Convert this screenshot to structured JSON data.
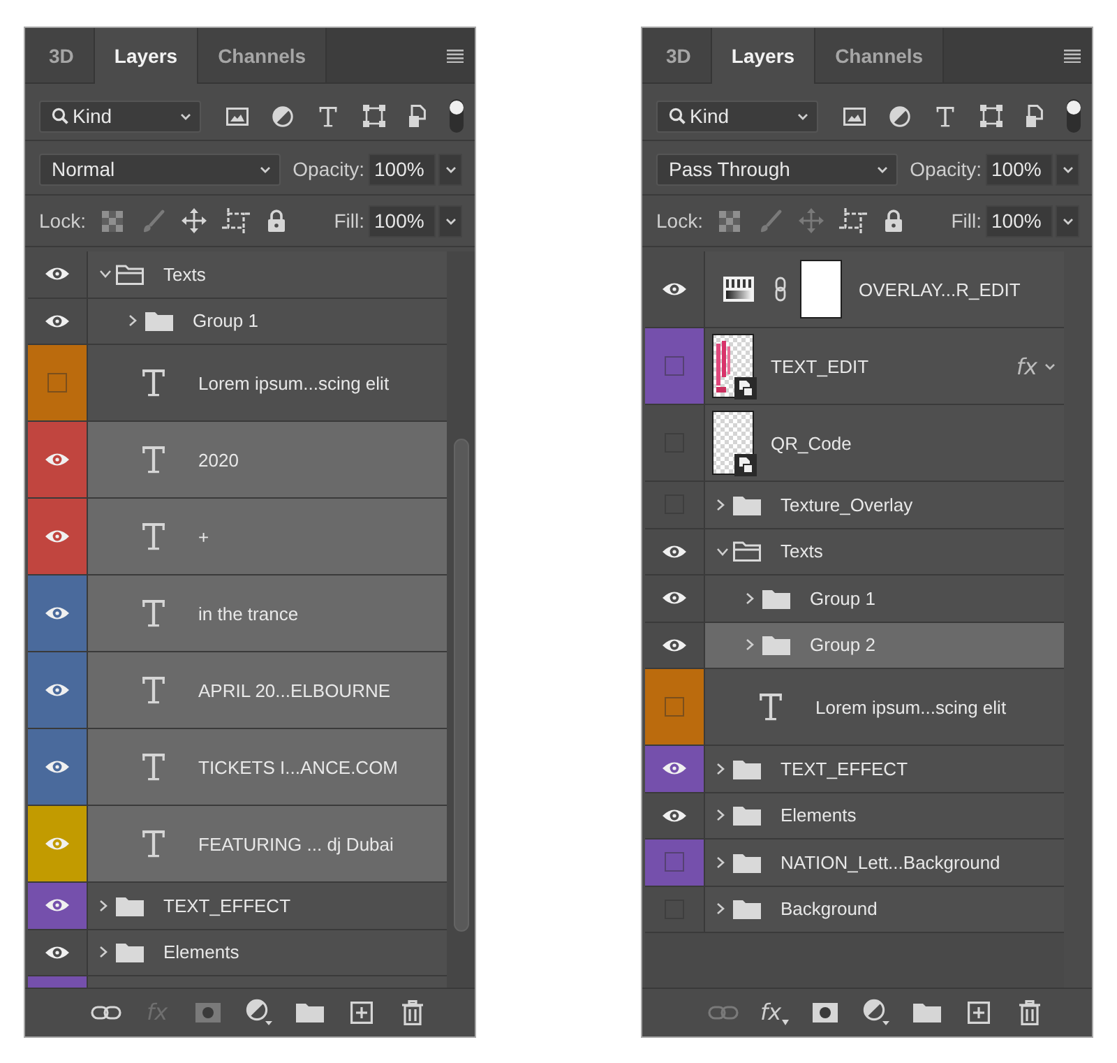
{
  "panels": [
    {
      "tabs": [
        {
          "label": "3D",
          "selected": false
        },
        {
          "label": "Layers",
          "selected": true
        },
        {
          "label": "Channels",
          "selected": false
        }
      ],
      "filter": {
        "label": "Kind",
        "on": true
      },
      "blend_mode": {
        "value": "Normal"
      },
      "opacity": {
        "label": "Opacity:",
        "value": "100%"
      },
      "lock": {
        "label": "Lock:",
        "buttons": [
          {
            "disabled": true
          },
          {
            "disabled": true
          },
          {
            "disabled": false
          },
          {
            "disabled": false
          },
          {
            "disabled": false
          }
        ]
      },
      "fill": {
        "label": "Fill:",
        "value": "100%"
      },
      "scrollable": true,
      "layers": [
        {
          "kind": "folder",
          "name": "Texts",
          "visible": true,
          "selected": false,
          "expanded": true,
          "children": [
            {
              "kind": "folder",
              "name": "Group 1",
              "visible": true,
              "selected": false,
              "expanded": false
            },
            {
              "kind": "text",
              "name": "Lorem ipsum...scing elit",
              "visible": false,
              "selected": false,
              "color": "#bb6b0d"
            },
            {
              "kind": "text",
              "name": "2020",
              "visible": true,
              "selected": true,
              "color": "#c1453f"
            },
            {
              "kind": "text",
              "name": "+",
              "visible": true,
              "selected": true,
              "color": "#c1453f"
            },
            {
              "kind": "text",
              "name": "in the trance",
              "visible": true,
              "selected": true,
              "color": "#4a6a9c"
            },
            {
              "kind": "text",
              "name": "APRIL 20...ELBOURNE",
              "visible": true,
              "selected": true,
              "color": "#4a6a9c"
            },
            {
              "kind": "text",
              "name": "TICKETS I...ANCE.COM",
              "visible": true,
              "selected": true,
              "color": "#4a6a9c"
            },
            {
              "kind": "text",
              "name": "FEATURING ... dj Dubai",
              "visible": true,
              "selected": true,
              "color": "#c29b00"
            }
          ]
        },
        {
          "kind": "folder",
          "name": "TEXT_EFFECT",
          "visible": true,
          "selected": false,
          "expanded": false,
          "color": "#7550ac"
        },
        {
          "kind": "folder",
          "name": "Elements",
          "visible": true,
          "selected": false,
          "expanded": false
        },
        {
          "kind": "clipped",
          "selected": false,
          "color": "#7550ac"
        }
      ],
      "bottom_bar": {
        "buttons": [
          {
            "disabled": false
          },
          {
            "label": "fx",
            "disabled": true
          },
          {
            "disabled": true
          },
          {
            "disabled": false
          },
          {
            "disabled": false
          },
          {
            "disabled": false
          },
          {
            "disabled": false
          }
        ]
      }
    },
    {
      "tabs": [
        {
          "label": "3D",
          "selected": false
        },
        {
          "label": "Layers",
          "selected": true
        },
        {
          "label": "Channels",
          "selected": false
        }
      ],
      "filter": {
        "label": "Kind",
        "on": true
      },
      "blend_mode": {
        "value": "Pass Through"
      },
      "opacity": {
        "label": "Opacity:",
        "value": "100%"
      },
      "lock": {
        "label": "Lock:",
        "buttons": [
          {
            "disabled": true
          },
          {
            "disabled": true
          },
          {
            "disabled": true
          },
          {
            "disabled": false
          },
          {
            "disabled": false
          }
        ]
      },
      "fill": {
        "label": "Fill:",
        "value": "100%"
      },
      "scrollable": false,
      "layers": [
        {
          "kind": "adjustment",
          "name": "OVERLAY...R_EDIT",
          "visible": true,
          "selected": false
        },
        {
          "kind": "smart",
          "name": "TEXT_EDIT",
          "visible": false,
          "selected": false,
          "color": "#7550ac",
          "thumbnail": {
            "kind": "lettering"
          },
          "effects": "fx"
        },
        {
          "kind": "smart",
          "name": "QR_Code",
          "visible": false,
          "selected": false,
          "thumbnail": {
            "kind": "blank"
          }
        },
        {
          "kind": "folder",
          "name": "Texture_Overlay",
          "visible": false,
          "selected": false,
          "expanded": false
        },
        {
          "kind": "folder",
          "name": "Texts",
          "visible": true,
          "selected": false,
          "expanded": true,
          "children": [
            {
              "kind": "folder",
              "name": "Group 1",
              "visible": true,
              "selected": false,
              "expanded": false
            },
            {
              "kind": "folder",
              "name": "Group 2",
              "visible": true,
              "selected": true,
              "expanded": false
            },
            {
              "kind": "text",
              "name": "Lorem ipsum...scing elit",
              "visible": false,
              "selected": false,
              "color": "#bb6b0d"
            }
          ]
        },
        {
          "kind": "folder",
          "name": "TEXT_EFFECT",
          "visible": true,
          "selected": false,
          "expanded": false,
          "color": "#7550ac"
        },
        {
          "kind": "folder",
          "name": "Elements",
          "visible": true,
          "selected": false,
          "expanded": false
        },
        {
          "kind": "folder",
          "name": "NATION_Lett...Background",
          "visible": false,
          "selected": false,
          "expanded": false,
          "color": "#7550ac"
        },
        {
          "kind": "folder",
          "name": "Background",
          "visible": false,
          "selected": false,
          "expanded": false
        }
      ],
      "bottom_bar": {
        "buttons": [
          {
            "disabled": true
          },
          {
            "label": "fx",
            "disabled": false
          },
          {
            "disabled": false
          },
          {
            "disabled": false
          },
          {
            "disabled": false
          },
          {
            "disabled": false
          },
          {
            "disabled": false
          }
        ]
      }
    }
  ]
}
